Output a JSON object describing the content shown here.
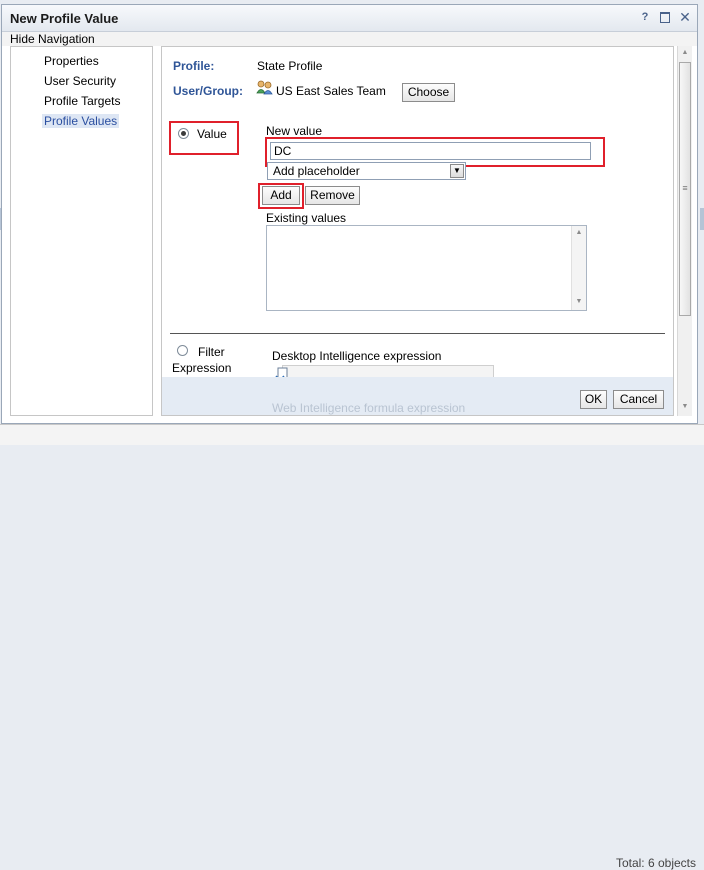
{
  "dialog": {
    "title": "New Profile Value",
    "help_glyph": "?",
    "close_glyph": "✕",
    "hide_navigation": "Hide Navigation"
  },
  "nav": {
    "items": [
      {
        "label": "Properties"
      },
      {
        "label": "User Security"
      },
      {
        "label": "Profile Targets"
      },
      {
        "label": "Profile Values",
        "active": true
      }
    ]
  },
  "profile": {
    "profile_label": "Profile:",
    "profile_value": "State Profile",
    "group_label": "User/Group:",
    "group_value": "US East Sales Team",
    "choose_button": "Choose"
  },
  "value_option": {
    "radio_label": "Value",
    "selected": true,
    "new_value_label": "New value",
    "new_value_input": "DC",
    "placeholder_select": "Add placeholder",
    "add_button": "Add",
    "remove_button": "Remove",
    "existing_values_label": "Existing values",
    "existing_values": []
  },
  "filter_option": {
    "radio_label_line1": "Filter",
    "radio_label_line2": "Expression",
    "selected": false,
    "desktop_expression_label": "Desktop Intelligence expression",
    "web_formula_label": "Web Intelligence formula expression"
  },
  "footer": {
    "ok_button": "OK",
    "cancel_button": "Cancel"
  },
  "background": {
    "status_text": "Total: 6 objects"
  },
  "colors": {
    "highlight_red": "#e0202b",
    "label_blue": "#2f5597",
    "active_nav": "#2b4fa0"
  }
}
